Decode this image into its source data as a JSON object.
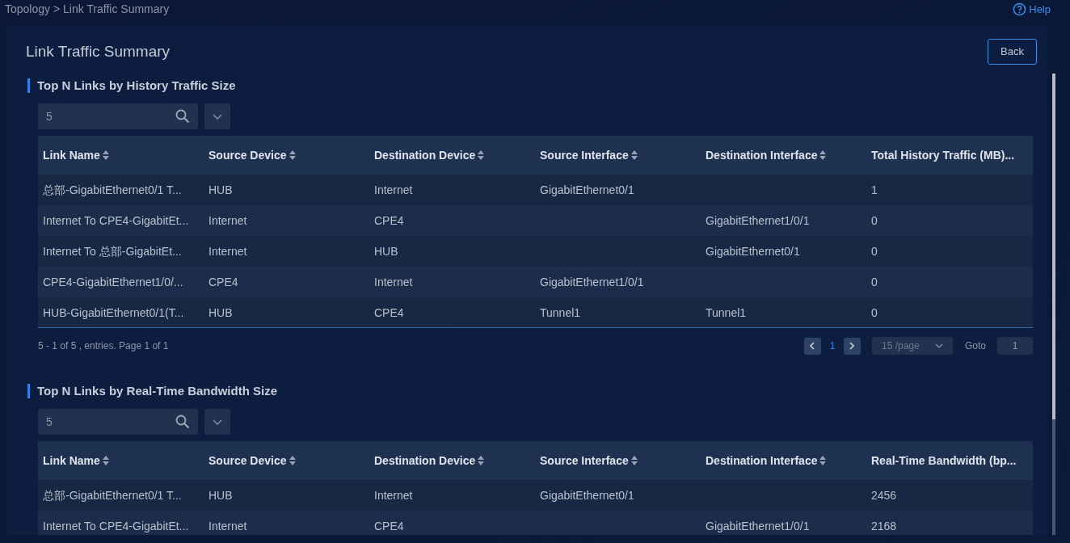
{
  "breadcrumb": "Topology > Link Traffic Summary",
  "help": "Help",
  "title": "Link Traffic Summary",
  "back_button": "Back",
  "sections": [
    {
      "heading": "Top N Links by History Traffic Size",
      "top_n": "5",
      "columns": [
        {
          "label": "Link Name",
          "sortable": true
        },
        {
          "label": "Source Device",
          "sortable": true
        },
        {
          "label": "Destination Device",
          "sortable": true
        },
        {
          "label": "Source Interface",
          "sortable": true
        },
        {
          "label": "Destination Interface",
          "sortable": true
        },
        {
          "label": "Total History Traffic (MB)...",
          "sortable": false
        }
      ],
      "rows": [
        [
          "总部-GigabitEthernet0/1 T...",
          "HUB",
          "Internet",
          "GigabitEthernet0/1",
          "",
          "1"
        ],
        [
          "Internet To CPE4-GigabitEt...",
          "Internet",
          "CPE4",
          "",
          "GigabitEthernet1/0/1",
          "0"
        ],
        [
          "Internet To 总部-GigabitEt...",
          "Internet",
          "HUB",
          "",
          "GigabitEthernet0/1",
          "0"
        ],
        [
          "CPE4-GigabitEthernet1/0/...",
          "CPE4",
          "Internet",
          "GigabitEthernet1/0/1",
          "",
          "0"
        ],
        [
          "HUB-GigabitEthernet0/1(T...",
          "HUB",
          "CPE4",
          "Tunnel1",
          "Tunnel1",
          "0"
        ]
      ],
      "pagination": {
        "summary": "5 - 1 of 5 , entries. Page 1 of 1",
        "pages": [
          {
            "label": "1",
            "selected": true
          }
        ],
        "page_size": "15 /page",
        "goto_label": "Goto",
        "goto_value": "1"
      }
    },
    {
      "heading": "Top N Links by Real-Time Bandwidth Size",
      "top_n": "5",
      "columns": [
        {
          "label": "Link Name",
          "sortable": true
        },
        {
          "label": "Source Device",
          "sortable": true
        },
        {
          "label": "Destination Device",
          "sortable": true
        },
        {
          "label": "Source Interface",
          "sortable": true
        },
        {
          "label": "Destination Interface",
          "sortable": true
        },
        {
          "label": "Real-Time Bandwidth (bp...",
          "sortable": false
        }
      ],
      "rows": [
        [
          "总部-GigabitEthernet0/1 T...",
          "HUB",
          "Internet",
          "GigabitEthernet0/1",
          "",
          "2456"
        ],
        [
          "Internet To CPE4-GigabitEt...",
          "Internet",
          "CPE4",
          "",
          "GigabitEthernet1/0/1",
          "2168"
        ]
      ]
    }
  ]
}
